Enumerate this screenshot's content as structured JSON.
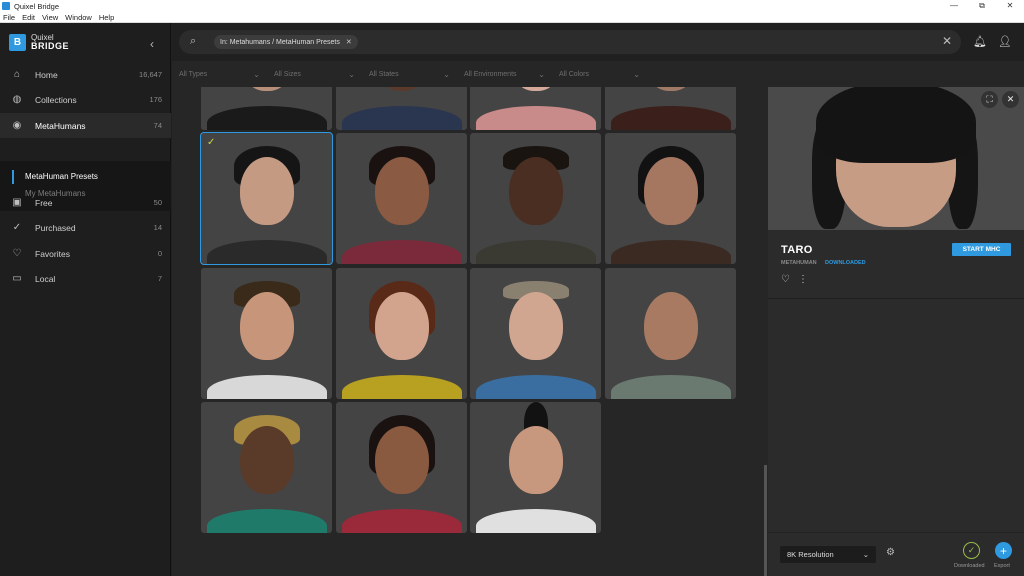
{
  "window": {
    "title": "Quixel Bridge",
    "minimize": "—",
    "maximize": "⧉",
    "close": "✕"
  },
  "menu": [
    "File",
    "Edit",
    "View",
    "Window",
    "Help"
  ],
  "logo": {
    "line1": "Quixel",
    "line2": "BRIDGE",
    "mark": "B"
  },
  "sidebar": {
    "items": [
      {
        "label": "Home",
        "count": "16,647",
        "icon": "home-icon"
      },
      {
        "label": "Collections",
        "count": "176",
        "icon": "globe-icon"
      },
      {
        "label": "MetaHumans",
        "count": "74",
        "icon": "user-circle-icon"
      },
      {
        "label": "Free",
        "count": "50",
        "icon": "gift-icon"
      },
      {
        "label": "Purchased",
        "count": "14",
        "icon": "check-circle-icon"
      },
      {
        "label": "Favorites",
        "count": "0",
        "icon": "heart-icon"
      },
      {
        "label": "Local",
        "count": "7",
        "icon": "monitor-icon"
      }
    ],
    "sub": {
      "presets": "MetaHuman Presets",
      "mine": "My MetaHumans"
    }
  },
  "search": {
    "chip": "In: Metahumans / MetaHuman Presets"
  },
  "filters": [
    "All Types",
    "All Sizes",
    "All States",
    "All Environments",
    "All Colors"
  ],
  "detail": {
    "name": "TARO",
    "tag1": "METAHUMAN",
    "tag2": "DOWNLOADED",
    "start": "START MHC",
    "resolution": "8K Resolution",
    "downloaded_label": "Downloaded",
    "export_label": "Export"
  },
  "colors": {
    "accent": "#2f9ae0",
    "downloaded": "#9bbd4a"
  }
}
